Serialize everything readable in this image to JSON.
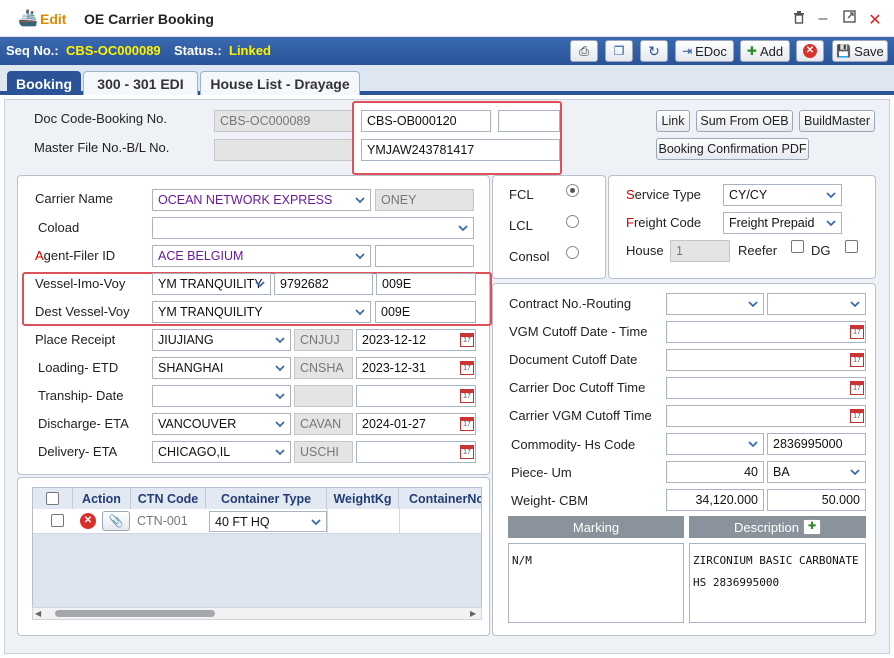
{
  "window": {
    "mode": "Edit",
    "title": "OE Carrier Booking",
    "controls": [
      "trash-icon",
      "minimize-icon",
      "maximize-icon",
      "close-icon"
    ]
  },
  "toolbar": {
    "seq_label": "Seq No.:",
    "seq_value": "CBS-OC000089",
    "status_label": "Status.:",
    "status_value": "Linked",
    "edoc_label": "EDoc",
    "add_label": "Add",
    "save_label": "Save"
  },
  "tabs": [
    {
      "label": "Booking",
      "active": true
    },
    {
      "label": "300 - 301 EDI",
      "active": false
    },
    {
      "label": "House List - Drayage",
      "active": false
    }
  ],
  "header": {
    "doc_code_label": "Doc Code-Booking No.",
    "doc_code_value": "CBS-OC000089",
    "booking_no": "CBS-OB000120",
    "booking_extra": "",
    "master_label": "Master File No.-B/L No.",
    "master_file": "",
    "bl_no": "YMJAW243781417",
    "link_btn": "Link",
    "sum_btn": "Sum From OEB",
    "build_btn": "BuildMaster",
    "pdf_btn": "Booking Confirmation PDF"
  },
  "left": {
    "carrier_label": "Carrier Name",
    "carrier_value": "OCEAN NETWORK EXPRESS",
    "carrier_code": "ONEY",
    "coload_label": "Coload",
    "coload_value": "",
    "agent_label_first": "A",
    "agent_label_rest": "gent-Filer ID",
    "agent_value": "ACE BELGIUM",
    "agent_extra": "",
    "vessel_label": "Vessel-Imo-Voy",
    "vessel_value": "YM TRANQUILITY",
    "vessel_imo": "9792682",
    "vessel_voy": "009E",
    "dest_vessel_label": "Dest Vessel-Voy",
    "dest_vessel_value": "YM TRANQUILITY",
    "dest_vessel_voy": "009E",
    "place_label": "Place Receipt",
    "place_value": "JIUJIANG",
    "place_code": "CNJUJ",
    "place_date": "2023-12-12",
    "loading_label": "Loading- ETD",
    "loading_value": "SHANGHAI",
    "loading_code": "CNSHA",
    "loading_date": "2023-12-31",
    "tranship_label": "Tranship- Date",
    "tranship_value": "",
    "tranship_code": "",
    "tranship_date": "",
    "discharge_label": "Discharge- ETA",
    "discharge_value": "VANCOUVER",
    "discharge_code": "CAVAN",
    "discharge_date": "2024-01-27",
    "delivery_label": "Delivery- ETA",
    "delivery_value": "CHICAGO,IL",
    "delivery_code": "USCHI",
    "delivery_date": ""
  },
  "mode": {
    "fcl": "FCL",
    "lcl": "LCL",
    "consol": "Consol",
    "selected": "FCL"
  },
  "service": {
    "service_label_first": "S",
    "service_label_rest": "ervice Type",
    "service_value": "CY/CY",
    "freight_label_first": "F",
    "freight_label_rest": "reight Code",
    "freight_value": "Freight Prepaid",
    "house_label": "House",
    "house_value": "1",
    "reefer_label": "Reefer",
    "dg_label": "DG"
  },
  "right": {
    "contract_label": "Contract No.-Routing",
    "vgm_cutoff_label": "VGM Cutoff Date - Time",
    "doc_cutoff_label": "Document Cutoff Date",
    "carrier_doc_label": "Carrier Doc Cutoff Time",
    "carrier_vgm_label": "Carrier VGM Cutoff Time",
    "commodity_label": "Commodity- Hs Code",
    "hs_code": "2836995000",
    "piece_label": "Piece- Um",
    "piece_value": "40",
    "piece_um": "BA",
    "weight_label": "Weight- CBM",
    "weight_value": "34,120.000",
    "cbm_value": "50.000",
    "marking_header": "Marking",
    "description_header": "Description",
    "marking_text": "N/M",
    "description_text": "ZIRCONIUM BASIC CARBONATE\nHS 2836995000"
  },
  "container_grid": {
    "headers": [
      "Action",
      "CTN Code",
      "Container Type",
      "WeightKg",
      "ContainerNo"
    ],
    "rows": [
      {
        "ctn_code": "CTN-001",
        "type": "40 FT HQ",
        "weight": "",
        "container_no": ""
      }
    ]
  },
  "colors": {
    "toolbar_bg": "#2a5398",
    "highlight_value": "#fff200",
    "mode_edit": "#e08a00",
    "carrier_text": "#6a1b9a",
    "callout_border": "#e0505a"
  }
}
